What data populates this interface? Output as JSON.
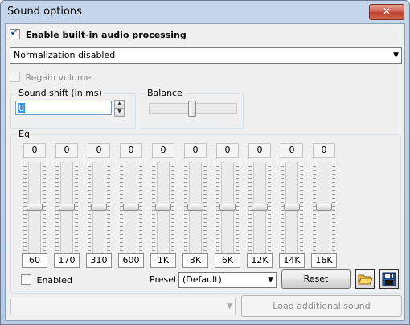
{
  "window": {
    "title": "Sound options",
    "close_glyph": "✕"
  },
  "processing": {
    "checkbox_label": "Enable built-in audio processing",
    "checked": true
  },
  "normalization": {
    "selected": "Normalization disabled"
  },
  "regain": {
    "label": "Regain volume",
    "checked": false,
    "enabled": false
  },
  "sound_shift": {
    "label": "Sound shift (in ms)",
    "value": "0"
  },
  "balance": {
    "label": "Balance",
    "level": 0.5
  },
  "eq": {
    "label": "Eq",
    "bands": [
      {
        "value": "0",
        "freq": "60",
        "level": 0.5
      },
      {
        "value": "0",
        "freq": "170",
        "level": 0.5
      },
      {
        "value": "0",
        "freq": "310",
        "level": 0.5
      },
      {
        "value": "0",
        "freq": "600",
        "level": 0.5
      },
      {
        "value": "0",
        "freq": "1K",
        "level": 0.5
      },
      {
        "value": "0",
        "freq": "3K",
        "level": 0.5
      },
      {
        "value": "0",
        "freq": "6K",
        "level": 0.5
      },
      {
        "value": "0",
        "freq": "12K",
        "level": 0.5
      },
      {
        "value": "0",
        "freq": "14K",
        "level": 0.5
      },
      {
        "value": "0",
        "freq": "16K",
        "level": 0.5
      }
    ],
    "enabled_label": "Enabled",
    "enabled_checked": false,
    "preset_label": "Preset",
    "preset_selected": "(Default)",
    "reset_label": "Reset",
    "open_icon": "folder-open-icon",
    "save_icon": "floppy-save-icon"
  },
  "additional": {
    "combo_value": "",
    "load_label": "Load additional sound"
  }
}
